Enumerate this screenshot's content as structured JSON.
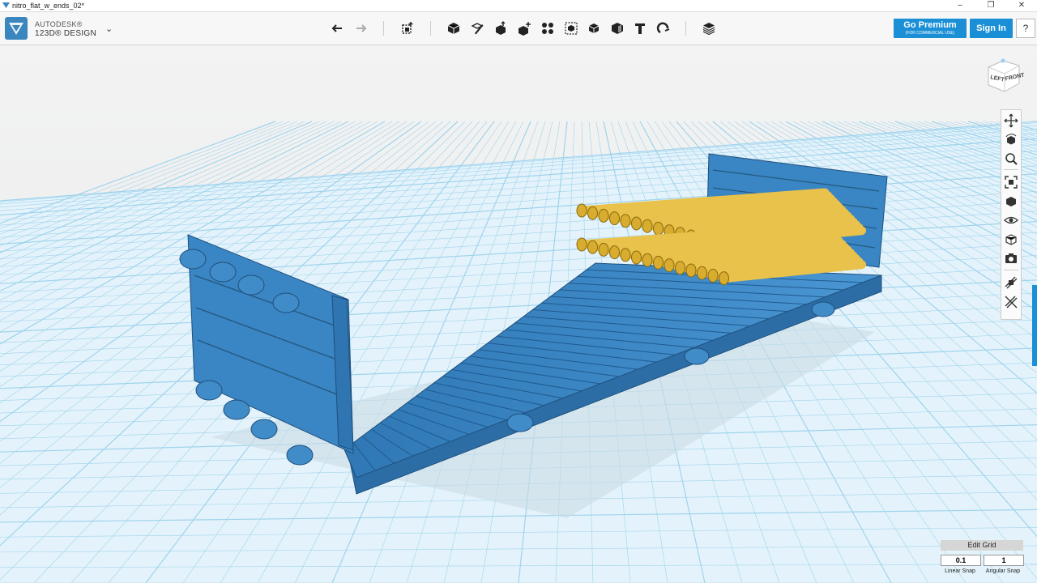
{
  "window": {
    "title": "nitro_flat_w_ends_02*",
    "controls": [
      "–",
      "❐",
      "✕"
    ]
  },
  "brand": {
    "line1": "AUTODESK®",
    "line2": "123D® DESIGN"
  },
  "toolbar": {
    "tools": [
      {
        "name": "undo-icon"
      },
      {
        "name": "redo-icon"
      },
      {
        "name": "transform-icon"
      },
      {
        "name": "primitives-icon"
      },
      {
        "name": "sketch-icon"
      },
      {
        "name": "construct-icon"
      },
      {
        "name": "modify-icon"
      },
      {
        "name": "pattern-icon"
      },
      {
        "name": "group-icon"
      },
      {
        "name": "combine-icon"
      },
      {
        "name": "measure-icon"
      },
      {
        "name": "text-icon"
      },
      {
        "name": "snap-icon"
      },
      {
        "name": "material-icon"
      }
    ],
    "premium_label": "Go Premium",
    "premium_sub": "(FOR COMMERCIAL USE)",
    "signin_label": "Sign In",
    "help_label": "?"
  },
  "viewcube": {
    "left_label": "LEFT",
    "front_label": "FRONT"
  },
  "navbar": {
    "items": [
      "pan-icon",
      "orbit-icon",
      "zoom-icon",
      "fit-icon",
      "view-icon",
      "visibility-icon",
      "materials-outline-icon",
      "camera-icon",
      "snap-grid-icon",
      "hide-grid-icon"
    ]
  },
  "grid": {
    "edit_label": "Edit Grid",
    "linear_snap_value": "0.1",
    "angular_snap_value": "1",
    "linear_snap_label": "Linear Snap",
    "angular_snap_label": "Angular Snap"
  },
  "colors": {
    "accent": "#1a8fd6",
    "model_blue": "#3a85c4",
    "pipe_yellow": "#e8c24a",
    "grid_line": "#9fd3ec"
  }
}
